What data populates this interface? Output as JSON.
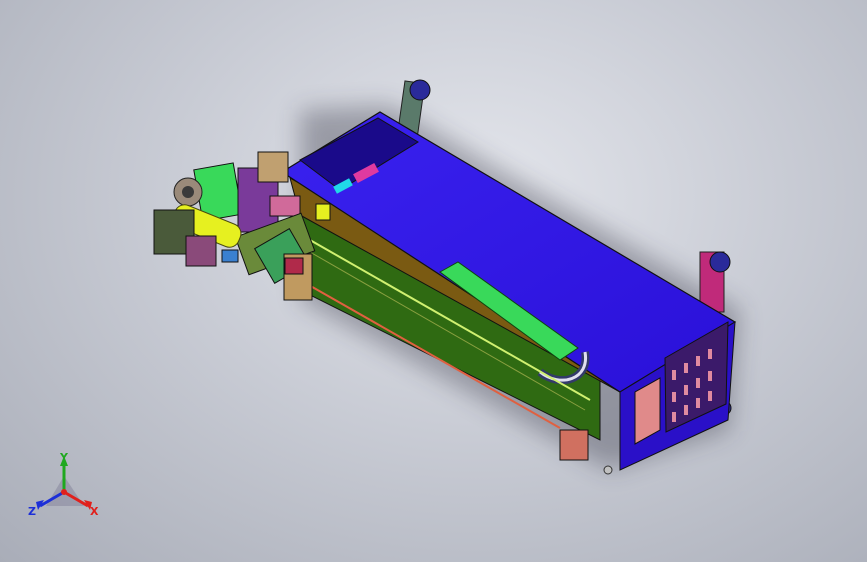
{
  "triad": {
    "x_label": "X",
    "y_label": "Y",
    "z_label": "Z",
    "x_color": "#e0201c",
    "y_color": "#1fa81f",
    "z_color": "#1c2fd8"
  },
  "model": {
    "housing_color": "#2a10e0",
    "front_panel_color": "#3b1a6a",
    "rail_color": "#2f6a12",
    "brown_band_color": "#7a5a12",
    "accent_green": "#39d95a",
    "accent_yellow": "#e6f020",
    "accent_pink": "#e05a7a"
  },
  "icons": [
    "axis-triad-icon"
  ]
}
